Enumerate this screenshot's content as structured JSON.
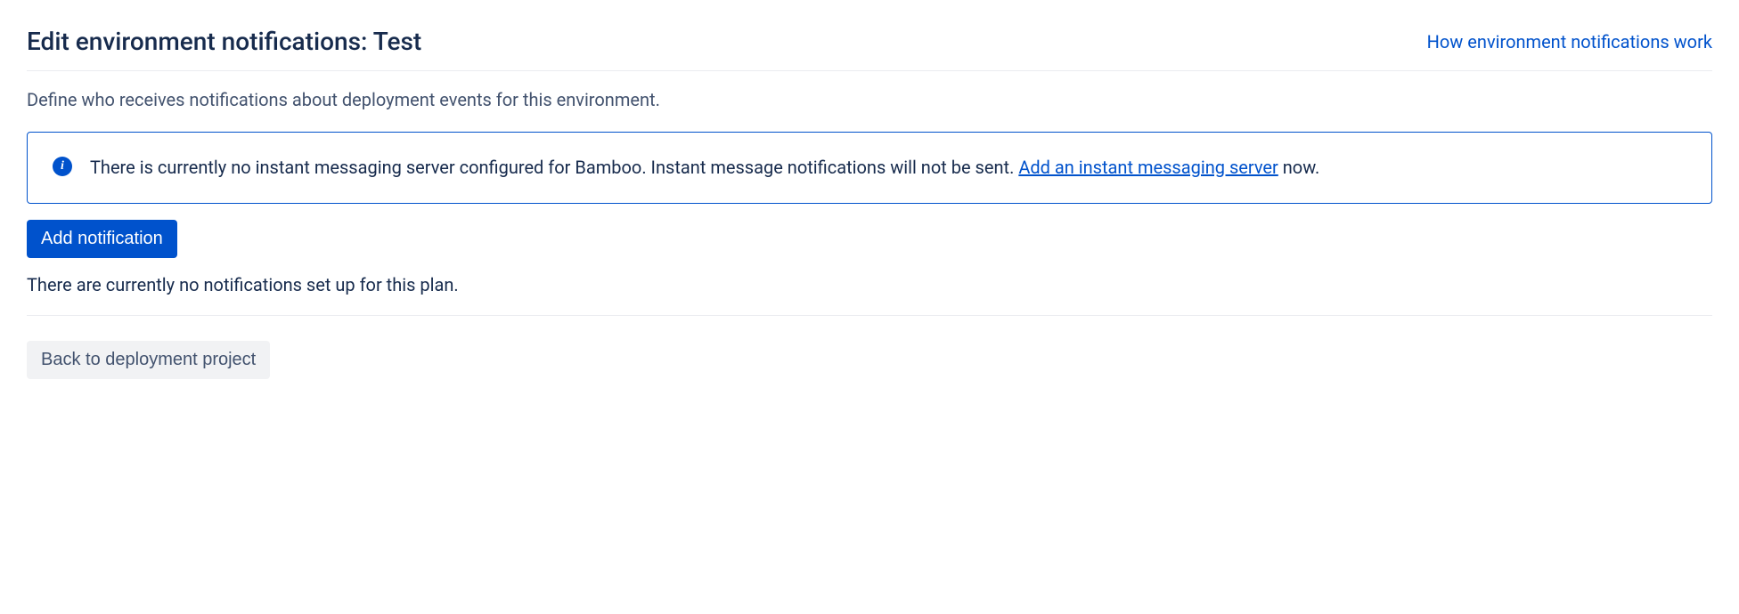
{
  "header": {
    "title": "Edit environment notifications: Test",
    "help_link": "How environment notifications work"
  },
  "description": "Define who receives notifications about deployment events for this environment.",
  "info_panel": {
    "message_before": "There is currently no instant messaging server configured for Bamboo. Instant message notifications will not be sent. ",
    "link_text": "Add an instant messaging server",
    "message_after": " now."
  },
  "buttons": {
    "add_notification": "Add notification",
    "back_to_project": "Back to deployment project"
  },
  "empty_state": "There are currently no notifications set up for this plan."
}
